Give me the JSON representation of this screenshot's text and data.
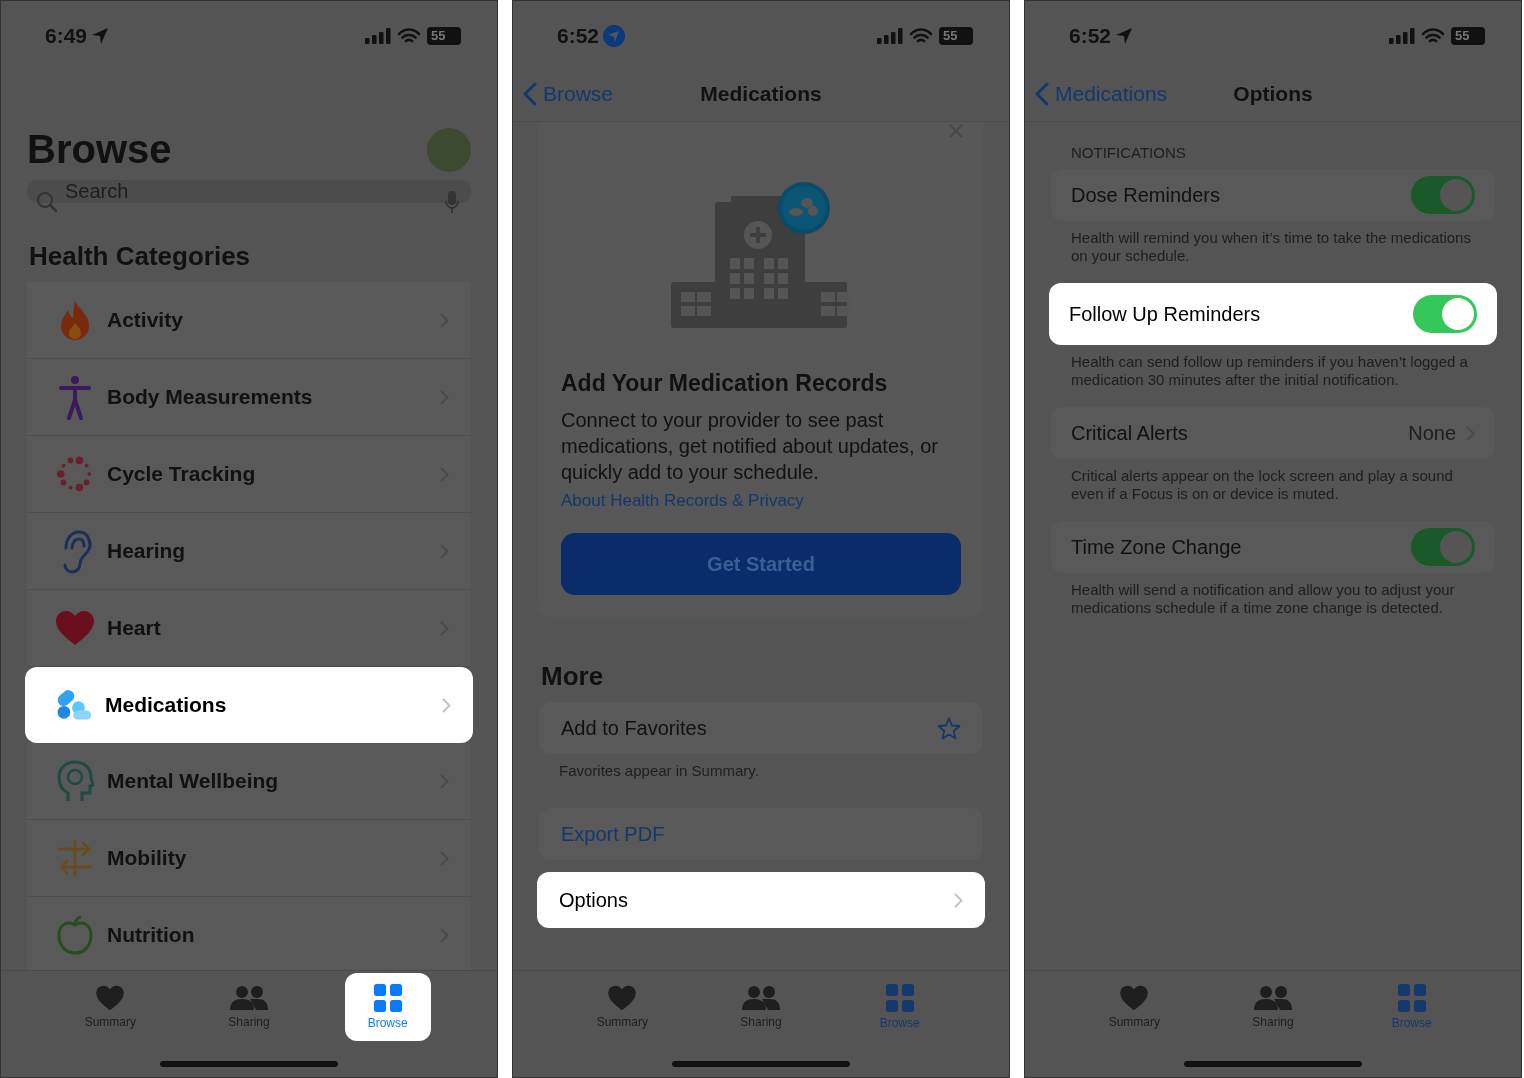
{
  "phones": [
    {
      "kind": "browse",
      "status": {
        "time": "6:49",
        "battery": "55"
      },
      "title": "Browse",
      "search": {
        "placeholder": "Search"
      },
      "section": "Health Categories",
      "categories": [
        {
          "label": "Activity",
          "highlighted": false
        },
        {
          "label": "Body Measurements",
          "highlighted": false
        },
        {
          "label": "Cycle Tracking",
          "highlighted": false
        },
        {
          "label": "Hearing",
          "highlighted": false
        },
        {
          "label": "Heart",
          "highlighted": false
        },
        {
          "label": "Medications",
          "highlighted": true
        },
        {
          "label": "Mental Wellbeing",
          "highlighted": false
        },
        {
          "label": "Mobility",
          "highlighted": false
        },
        {
          "label": "Nutrition",
          "highlighted": false
        }
      ],
      "tabs": [
        {
          "label": "Summary",
          "selected": false,
          "highlighted": false
        },
        {
          "label": "Sharing",
          "selected": false,
          "highlighted": false
        },
        {
          "label": "Browse",
          "selected": true,
          "highlighted": true
        }
      ]
    },
    {
      "kind": "medications",
      "status": {
        "time": "6:52",
        "battery": "55"
      },
      "nav": {
        "back": "Browse",
        "title": "Medications"
      },
      "card": {
        "title": "Add Your Medication Records",
        "body": "Connect to your provider to see past medications, get notified about updates, or quickly add to your schedule.",
        "link": "About Health Records & Privacy",
        "button": "Get Started"
      },
      "more": {
        "heading": "More",
        "favorite": {
          "label": "Add to Favorites",
          "footer": "Favorites appear in Summary."
        },
        "export": "Export PDF",
        "options": {
          "label": "Options",
          "highlighted": true
        }
      },
      "tabs": [
        {
          "label": "Summary",
          "selected": false,
          "highlighted": false
        },
        {
          "label": "Sharing",
          "selected": false,
          "highlighted": false
        },
        {
          "label": "Browse",
          "selected": true,
          "highlighted": false
        }
      ]
    },
    {
      "kind": "options",
      "status": {
        "time": "6:52",
        "battery": "55"
      },
      "nav": {
        "back": "Medications",
        "title": "Options"
      },
      "section": "NOTIFICATIONS",
      "rows": [
        {
          "kind": "toggle",
          "label": "Dose Reminders",
          "on": true,
          "highlighted": false,
          "footer": "Health will remind you when it’s time to take the medications on your schedule."
        },
        {
          "kind": "toggle",
          "label": "Follow Up Reminders",
          "on": true,
          "highlighted": true,
          "footer": "Health can send follow up reminders if you haven’t logged a medication 30 minutes after the initial notification."
        },
        {
          "kind": "value",
          "label": "Critical Alerts",
          "value": "None",
          "highlighted": false,
          "footer": "Critical alerts appear on the lock screen and play a sound even if a Focus is on or device is muted."
        },
        {
          "kind": "toggle",
          "label": "Time Zone Change",
          "on": true,
          "highlighted": false,
          "footer": "Health will send a notification and allow you to adjust your medications schedule if a time zone change is detected."
        }
      ],
      "tabs": [
        {
          "label": "Summary",
          "selected": false,
          "highlighted": false
        },
        {
          "label": "Sharing",
          "selected": false,
          "highlighted": false
        },
        {
          "label": "Browse",
          "selected": true,
          "highlighted": false
        }
      ]
    }
  ]
}
